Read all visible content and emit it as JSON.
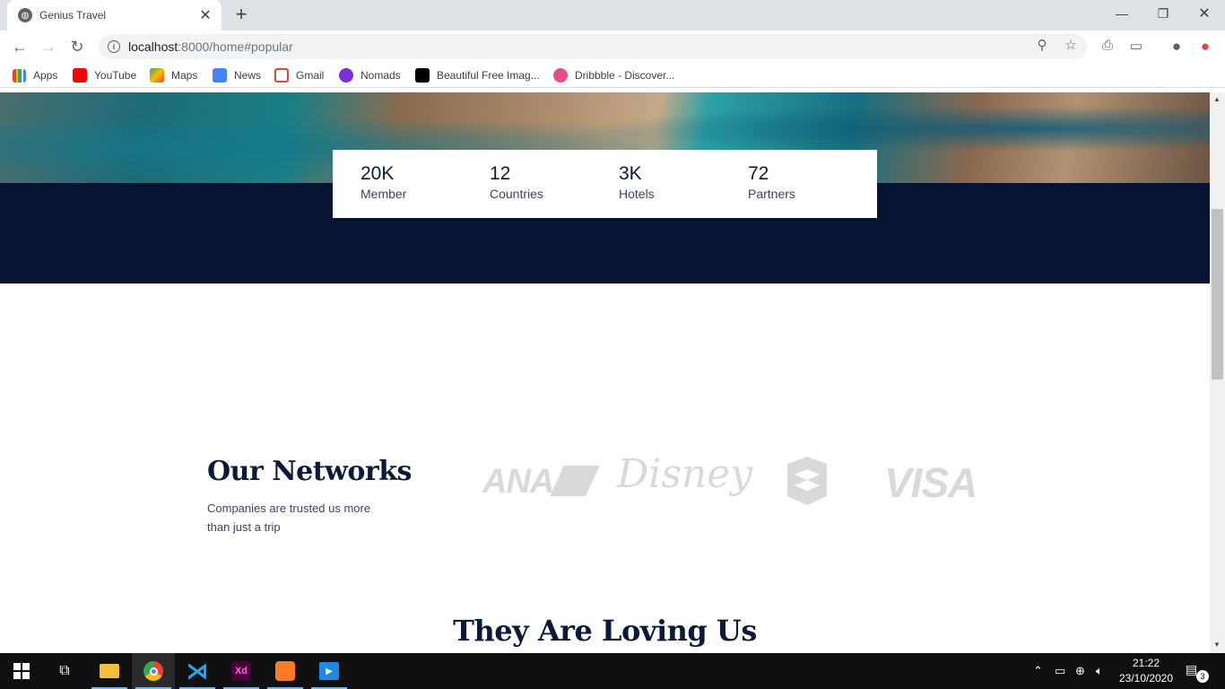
{
  "browser": {
    "tab_title": "Genius Travel",
    "url_host": "localhost",
    "url_rest": ":8000/home#popular",
    "bookmarks": [
      "Apps",
      "YouTube",
      "Maps",
      "News",
      "Gmail",
      "Nomads",
      "Beautiful Free Imag...",
      "Dribbble - Discover..."
    ]
  },
  "stats": [
    {
      "value": "20K",
      "label": "Member"
    },
    {
      "value": "12",
      "label": "Countries"
    },
    {
      "value": "3K",
      "label": "Hotels"
    },
    {
      "value": "72",
      "label": "Partners"
    }
  ],
  "networks": {
    "title": "Our Networks",
    "subtitle": "Companies are trusted us more than just a trip",
    "logos": [
      "ANA",
      "Disney",
      "VISA"
    ]
  },
  "testimonials": {
    "title": "They Are Loving Us"
  },
  "taskbar": {
    "time": "21:22",
    "date": "23/10/2020",
    "notifications": "3"
  }
}
